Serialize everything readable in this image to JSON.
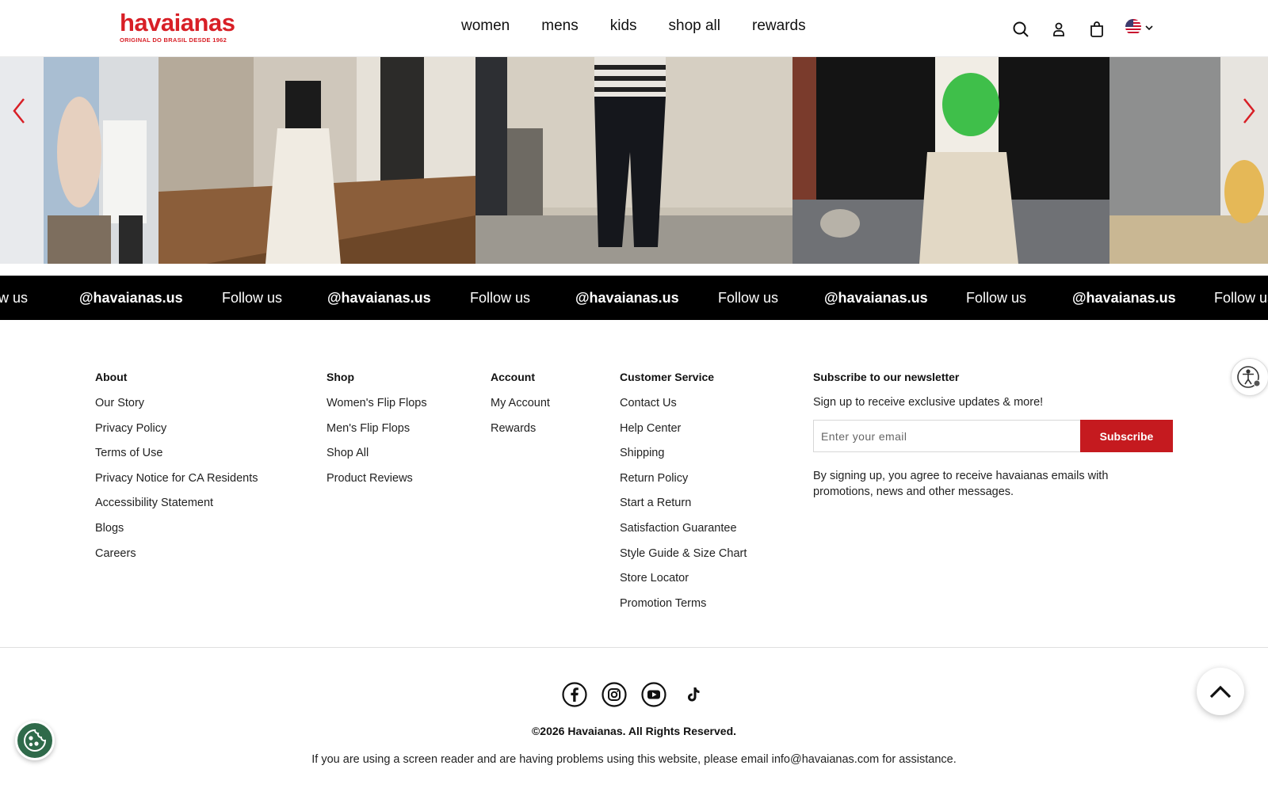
{
  "header": {
    "logo_text": "havaianas",
    "logo_tagline": "ORIGINAL DO BRASIL DESDE 1962",
    "nav": [
      "women",
      "mens",
      "kids",
      "shop all",
      "rewards"
    ],
    "icons": [
      "search-icon",
      "account-icon",
      "bag-icon",
      "us-flag-icon",
      "chevron-down-icon"
    ]
  },
  "carousel": {
    "prev_icon": "chevron-left-icon",
    "next_icon": "chevron-right-icon",
    "accent_color": "#d81f26"
  },
  "marquee": {
    "items": [
      "w us",
      "@havaianas.us",
      "Follow us",
      "@havaianas.us",
      "Follow us",
      "@havaianas.us",
      "Follow us",
      "@havaianas.us",
      "Follow us",
      "@havaianas.us",
      "Follow us"
    ]
  },
  "footer": {
    "about": {
      "title": "About",
      "links": [
        "Our Story",
        "Privacy Policy",
        "Terms of Use",
        "Privacy Notice for CA Residents",
        "Accessibility Statement",
        "Blogs",
        "Careers"
      ]
    },
    "shop": {
      "title": "Shop",
      "links": [
        "Women's Flip Flops",
        "Men's Flip Flops",
        "Shop All",
        "Product Reviews"
      ]
    },
    "account": {
      "title": "Account",
      "links": [
        "My Account",
        "Rewards"
      ]
    },
    "service": {
      "title": "Customer Service",
      "links": [
        "Contact Us",
        "Help Center",
        "Shipping",
        "Return Policy",
        "Start a Return",
        "Satisfaction Guarantee",
        "Style Guide & Size Chart",
        "Store Locator",
        "Promotion Terms"
      ]
    },
    "newsletter": {
      "title": "Subscribe to our newsletter",
      "subtitle": "Sign up to receive exclusive updates & more!",
      "placeholder": "Enter your email",
      "button": "Subscribe",
      "legal": "By signing up, you agree to receive havaianas emails with promotions, news and other messages."
    },
    "socials": [
      "facebook-icon",
      "instagram-icon",
      "youtube-icon",
      "tiktok-icon"
    ],
    "copyright": "©2026 Havaianas. All Rights Reserved.",
    "screen_reader_note": "If you are using a screen reader and are having problems using this website, please email info@havaianas.com for assistance."
  },
  "colors": {
    "brand_red": "#d81f26",
    "button_red": "#c51a1f",
    "cookie_green": "#2f6a4a"
  }
}
